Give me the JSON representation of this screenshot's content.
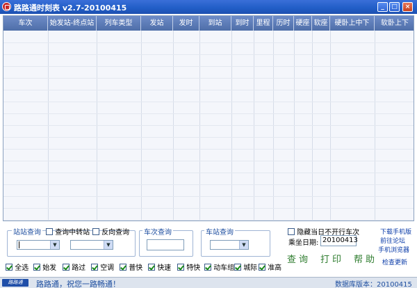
{
  "window": {
    "title": "路路通时刻表 v2.7-20100415",
    "minimize": "_",
    "maximize": "□",
    "close": "×"
  },
  "grid": {
    "columns": [
      "车次",
      "始发站-终点站",
      "列车类型",
      "发站",
      "发时",
      "到站",
      "到时",
      "里程",
      "历时",
      "硬座",
      "软座",
      "硬卧上中下",
      "软卧上下"
    ]
  },
  "station_query": {
    "label": "站站查询",
    "transfer_label": "查询中转站",
    "reverse_label": "反向查询",
    "from_value": "",
    "to_value": ""
  },
  "train_query": {
    "label": "车次查询",
    "value": ""
  },
  "station_lookup": {
    "label": "车站查询",
    "value": ""
  },
  "options": {
    "hide_label": "隐藏当日不开行车次",
    "date_label": "乘坐日期:",
    "date_value": "20100413"
  },
  "actions": {
    "query": "查询",
    "print": "打印",
    "help": "帮助"
  },
  "links": {
    "download": "下载手机版",
    "forum": "前往论坛",
    "mobile_browser": "手机浏览器",
    "check_update": "检查更新"
  },
  "filters": [
    {
      "label": "全选",
      "checked": true
    },
    {
      "label": "始发",
      "checked": true
    },
    {
      "label": "路过",
      "checked": true
    },
    {
      "label": "空调",
      "checked": true
    },
    {
      "label": "普快",
      "checked": true
    },
    {
      "label": "快速",
      "checked": true
    },
    {
      "label": "特快",
      "checked": true
    },
    {
      "label": "动车组",
      "checked": true
    },
    {
      "label": "城际",
      "checked": true
    },
    {
      "label": "准高",
      "checked": true
    }
  ],
  "status": {
    "logo": "路路通",
    "message": "路路通，祝您一路畅通！",
    "db_version": "数据库版本：20100415"
  }
}
